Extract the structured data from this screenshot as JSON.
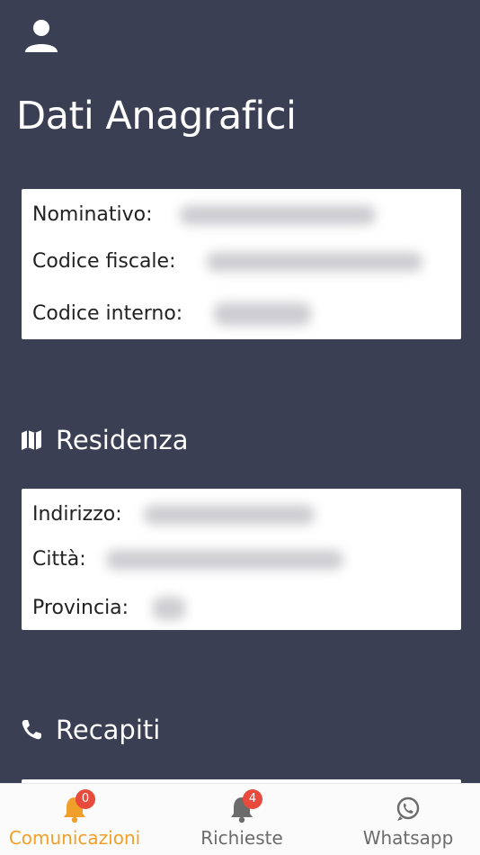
{
  "header": {
    "title": "Dati Anagrafici"
  },
  "anagrafica": {
    "rows": [
      {
        "label": "Nominativo:"
      },
      {
        "label": "Codice fiscale:"
      },
      {
        "label": "Codice interno:"
      }
    ]
  },
  "residenza": {
    "title": "Residenza",
    "rows": [
      {
        "label": "Indirizzo:"
      },
      {
        "label": "Città:"
      },
      {
        "label": "Provincia:"
      }
    ]
  },
  "recapiti": {
    "title": "Recapiti"
  },
  "nav": {
    "items": [
      {
        "label": "Comunicazioni",
        "badge": "0",
        "active": true
      },
      {
        "label": "Richieste",
        "badge": "4",
        "active": false
      },
      {
        "label": "Whatsapp",
        "badge": "",
        "active": false
      }
    ]
  },
  "colors": {
    "background": "#3b3f54",
    "accent": "#f0a02a",
    "badge": "#e84a3c",
    "inactive": "#6b6b6b"
  },
  "icons": {
    "profile": "person-icon",
    "residenza": "map-icon",
    "recapiti": "phone-icon",
    "comunicazioni": "bell-icon",
    "richieste": "bell-icon",
    "whatsapp": "whatsapp-icon"
  }
}
